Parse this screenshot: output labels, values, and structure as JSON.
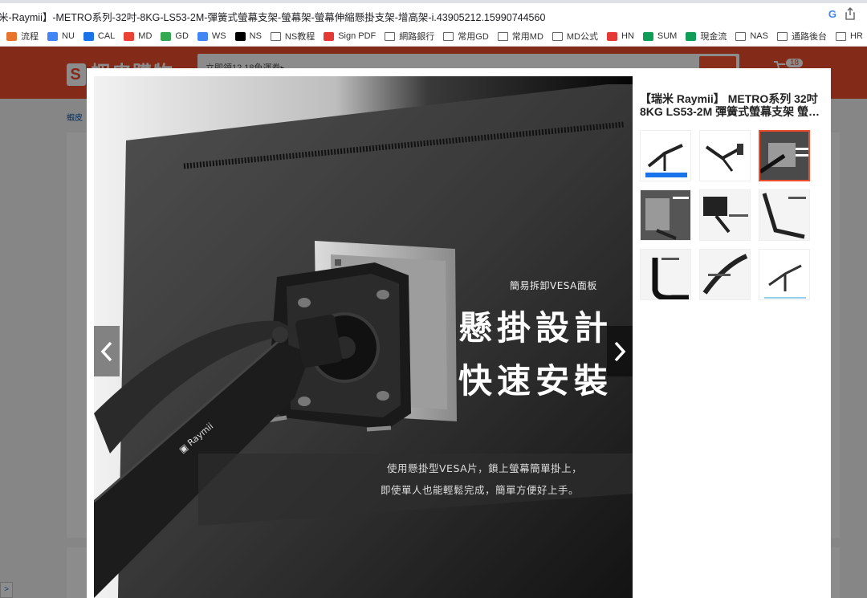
{
  "browser": {
    "url_title": "米-Raymii】-METRO系列-32吋-8KG-LS53-2M-彈簧式螢幕支架-螢幕架-螢幕伸縮懸掛支架-增高架-i.43905212.15990744560",
    "bookmarks": [
      {
        "label": "流程",
        "icon": "orange-square-icon",
        "color": "#e8732c"
      },
      {
        "label": "NU",
        "icon": "cloud-icon",
        "color": "#4285f4"
      },
      {
        "label": "CAL",
        "icon": "calendar-icon",
        "color": "#1a73e8"
      },
      {
        "label": "MD",
        "icon": "wave-icon",
        "color": "#e94235"
      },
      {
        "label": "GD",
        "icon": "drive-icon",
        "color": "#34a853"
      },
      {
        "label": "WS",
        "icon": "google-icon",
        "color": "#4285f4"
      },
      {
        "label": "NS",
        "icon": "notion-icon",
        "color": "#000000"
      },
      {
        "label": "NS教程",
        "icon": "folder-icon",
        "color": "#666666"
      },
      {
        "label": "Sign PDF",
        "icon": "heart-icon",
        "color": "#e53935"
      },
      {
        "label": "網路銀行",
        "icon": "folder-icon",
        "color": "#666666"
      },
      {
        "label": "常用GD",
        "icon": "folder-icon",
        "color": "#666666"
      },
      {
        "label": "常用MD",
        "icon": "folder-icon",
        "color": "#666666"
      },
      {
        "label": "MD公式",
        "icon": "folder-icon",
        "color": "#666666"
      },
      {
        "label": "HN",
        "icon": "hn-icon",
        "color": "#e53935"
      },
      {
        "label": "SUM",
        "icon": "sheet-plus-icon",
        "color": "#0f9d58"
      },
      {
        "label": "現金流",
        "icon": "sheet-plus-icon",
        "color": "#0f9d58"
      },
      {
        "label": "NAS",
        "icon": "folder-icon",
        "color": "#666666"
      },
      {
        "label": "通路後台",
        "icon": "folder-icon",
        "color": "#666666"
      },
      {
        "label": "HR",
        "icon": "folder-icon",
        "color": "#666666"
      }
    ]
  },
  "shop": {
    "logo": "蝦皮購物",
    "search_placeholder": "立即領12.18免運券▸",
    "cart_count": "18",
    "breadcrumb": "蝦皮",
    "side_tab": ">",
    "brand_color": "#ee4d2d"
  },
  "modal": {
    "product_title": "【瑞米 Raymii】 METRO系列 32吋 8KG LS53-2M 彈簧式螢幕支架 螢…",
    "main_image": {
      "caption_small": "簡易拆卸VESA面板",
      "title_line1": "懸掛設計",
      "title_line2": "快速安裝",
      "desc_line1": "使用懸掛型VESA片，鎖上螢幕簡單掛上，",
      "desc_line2": "即使單人也能輕鬆完成，簡單方便好上手。",
      "arm_brand": "Raymii"
    },
    "thumbnails": [
      {
        "label": "arm-photo-1",
        "active": false
      },
      {
        "label": "arm-photo-2",
        "active": false
      },
      {
        "label": "vesa-hanging-photo",
        "active": true
      },
      {
        "label": "desk-space-photo",
        "active": false
      },
      {
        "label": "tension-adjust-photo",
        "active": false
      },
      {
        "label": "desktop-clamp-photo",
        "active": false
      },
      {
        "label": "cable-management-photo",
        "active": false
      },
      {
        "label": "arm-angle-photo",
        "active": false
      },
      {
        "label": "dimensions-photo",
        "active": false
      }
    ],
    "prev_label": "‹",
    "next_label": "›"
  }
}
